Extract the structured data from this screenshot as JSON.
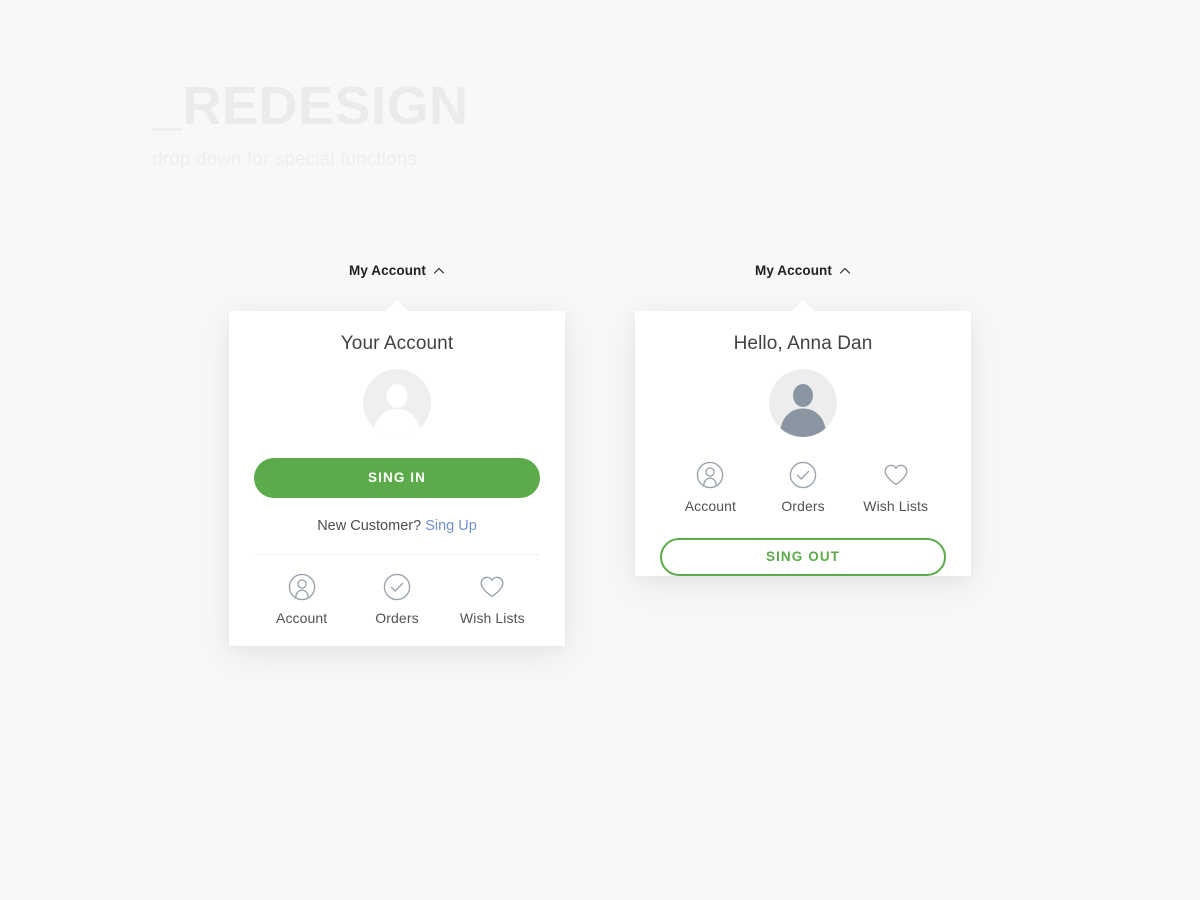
{
  "page": {
    "title": "_REDESIGN",
    "subtitle": "drop down for special functions"
  },
  "colors": {
    "background": "#f8f8f9",
    "panel": "#ffffff",
    "accent_green": "#5cab4a",
    "link_blue": "#7291cb",
    "icon_gray": "#9aa3ab",
    "avatar_circle": "#eeeeee",
    "avatar_circle_active": "#ececec",
    "avatar_person_active": "#8b96a3",
    "title_gray": "#ebebec",
    "divider": "#f0f0f1"
  },
  "dropdown_signed_out": {
    "trigger_label": "My Account",
    "trigger_icon": "chevron-up-icon",
    "panel_title": "Your Account",
    "avatar_icon": "avatar-placeholder-icon",
    "sign_in_label": "SING IN",
    "new_customer_text": "New Customer?",
    "sign_up_label": "Sing Up",
    "quick_links": [
      {
        "label": "Account",
        "icon": "account-circle-icon"
      },
      {
        "label": "Orders",
        "icon": "check-circle-icon"
      },
      {
        "label": "Wish Lists",
        "icon": "heart-icon"
      }
    ]
  },
  "dropdown_signed_in": {
    "trigger_label": "My Account",
    "trigger_icon": "chevron-up-icon",
    "panel_title": "Hello, Anna Dan",
    "avatar_icon": "avatar-user-icon",
    "sign_out_label": "SING OUT",
    "quick_links": [
      {
        "label": "Account",
        "icon": "account-circle-icon"
      },
      {
        "label": "Orders",
        "icon": "check-circle-icon"
      },
      {
        "label": "Wish Lists",
        "icon": "heart-icon"
      }
    ]
  }
}
